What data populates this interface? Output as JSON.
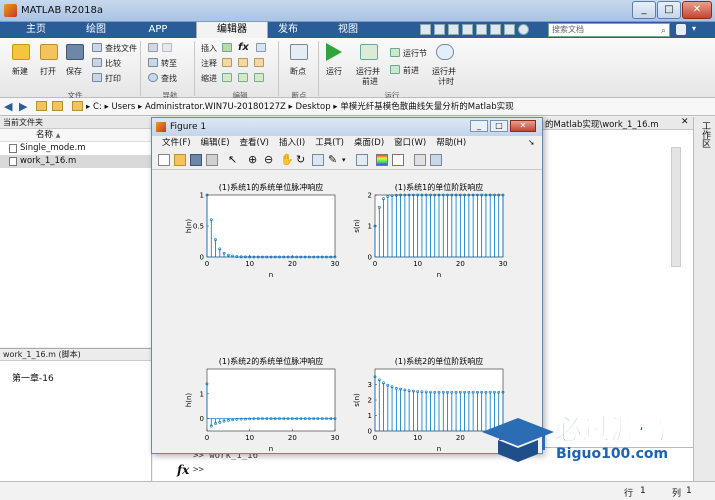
{
  "window": {
    "title": "MATLAB R2018a"
  },
  "tabs": [
    "主页",
    "绘图",
    "APP",
    "编辑器",
    "发布",
    "视图"
  ],
  "search": {
    "placeholder": "搜索文档"
  },
  "ribbon": {
    "file": {
      "new": "新建",
      "open": "打开",
      "save": "保存",
      "find_files": "查找文件",
      "compare": "比较",
      "print": "打印",
      "group": "文件"
    },
    "navigate": {
      "goto": "转至",
      "find": "查找",
      "group": "导航"
    },
    "edit": {
      "insert": "插入",
      "comment": "注释",
      "indent": "缩进",
      "fx": "fx",
      "group": "编辑"
    },
    "breakpoints": {
      "label": "断点",
      "group": "断点"
    },
    "run": {
      "run": "运行",
      "run_advance_1": "运行并",
      "run_advance_2": "前进",
      "run_section": "运行节",
      "advance": "前进",
      "run_time_1": "运行并",
      "run_time_2": "计时",
      "group": "运行"
    }
  },
  "address": {
    "path": [
      "C:",
      "Users",
      "Administrator.WIN7U-20180127Z",
      "Desktop",
      "单模光纤基模色散曲线矢量分析的Matlab实现"
    ]
  },
  "current_folder": {
    "header": "当前文件夹",
    "col_name": "名称",
    "sort": "▲",
    "files": [
      "Single_mode.m",
      "work_1_16.m"
    ]
  },
  "details": {
    "header": "work_1_16.m  (脚本)",
    "content": "第一章-16"
  },
  "editor_tab": "的Matlab实现\\work_1_16.m",
  "workspace_label": "工作区",
  "command": {
    "line1": ">> work_1_16",
    "prompt": ">>",
    "fx": "fx"
  },
  "status": {
    "row_label": "行",
    "row": "1",
    "col_label": "列",
    "col": "1"
  },
  "figure": {
    "title": "Figure 1",
    "menu": [
      "文件(F)",
      "编辑(E)",
      "查看(V)",
      "插入(I)",
      "工具(T)",
      "桌面(D)",
      "窗口(W)",
      "帮助(H)"
    ],
    "plots": [
      {
        "title": "(1)系统1的系统单位脉冲响应",
        "ylabel": "h(n)",
        "xlabel": "n",
        "yticks": [
          "0",
          "0.5",
          "1"
        ],
        "xticks": [
          "0",
          "10",
          "20",
          "30"
        ]
      },
      {
        "title": "(1)系统1的单位阶跃响应",
        "ylabel": "s(n)",
        "xlabel": "n",
        "yticks": [
          "0",
          "1",
          "2"
        ],
        "xticks": [
          "0",
          "10",
          "20",
          "30"
        ]
      },
      {
        "title": "(1)系统2的系统单位脉冲响应",
        "ylabel": "h(n)",
        "xlabel": "n",
        "yticks": [
          "0",
          "1"
        ],
        "xticks": [
          "0",
          "10",
          "20",
          "30"
        ]
      },
      {
        "title": "(1)系统2的单位阶跃响应",
        "ylabel": "s(n)",
        "xlabel": "n",
        "yticks": [
          "0",
          "1",
          "2",
          "3"
        ],
        "xticks": [
          "0",
          "10",
          "20",
          "30"
        ]
      }
    ]
  },
  "watermark": {
    "cn": "必过源码",
    "en": "Biguo100.com"
  },
  "colors": {
    "tabbar": "#2a5c9a",
    "stem": "#0072bd",
    "title_gradient": "#c3d5ea"
  },
  "chart_data": [
    {
      "type": "stem",
      "title": "(1)系统1的系统单位脉冲响应",
      "xlabel": "n",
      "ylabel": "h(n)",
      "xlim": [
        0,
        30
      ],
      "ylim": [
        0,
        1
      ],
      "x": [
        0,
        1,
        2,
        3,
        4,
        5,
        6,
        7,
        8,
        9,
        10,
        11,
        12,
        13,
        14,
        15,
        16,
        17,
        18,
        19,
        20,
        21,
        22,
        23,
        24,
        25,
        26,
        27,
        28,
        29,
        30
      ],
      "values": [
        1,
        0.6,
        0.28,
        0.13,
        0.06,
        0.03,
        0.015,
        0.007,
        0.003,
        0.002,
        0.001,
        0,
        0,
        0,
        0,
        0,
        0,
        0,
        0,
        0,
        0,
        0,
        0,
        0,
        0,
        0,
        0,
        0,
        0,
        0,
        0
      ]
    },
    {
      "type": "stem",
      "title": "(1)系统1的单位阶跃响应",
      "xlabel": "n",
      "ylabel": "s(n)",
      "xlim": [
        0,
        30
      ],
      "ylim": [
        0,
        2
      ],
      "x": [
        0,
        1,
        2,
        3,
        4,
        5,
        6,
        7,
        8,
        9,
        10,
        11,
        12,
        13,
        14,
        15,
        16,
        17,
        18,
        19,
        20,
        21,
        22,
        23,
        24,
        25,
        26,
        27,
        28,
        29,
        30
      ],
      "values": [
        1,
        1.6,
        1.88,
        1.95,
        1.98,
        1.99,
        2,
        2,
        2,
        2,
        2,
        2,
        2,
        2,
        2,
        2,
        2,
        2,
        2,
        2,
        2,
        2,
        2,
        2,
        2,
        2,
        2,
        2,
        2,
        2,
        2
      ]
    },
    {
      "type": "stem",
      "title": "(1)系统2的系统单位脉冲响应",
      "xlabel": "n",
      "ylabel": "h(n)",
      "xlim": [
        0,
        30
      ],
      "ylim": [
        -0.5,
        2
      ],
      "x": [
        0,
        1,
        2,
        3,
        4,
        5,
        6,
        7,
        8,
        9,
        10,
        11,
        12,
        13,
        14,
        15,
        16,
        17,
        18,
        19,
        20,
        21,
        22,
        23,
        24,
        25,
        26,
        27,
        28,
        29,
        30
      ],
      "values": [
        1.4,
        -0.3,
        -0.2,
        -0.15,
        -0.1,
        -0.07,
        -0.05,
        -0.03,
        -0.02,
        -0.015,
        -0.01,
        -0.005,
        0,
        0,
        0,
        0,
        0,
        0,
        0,
        0,
        0,
        0,
        0,
        0,
        0,
        0,
        0,
        0,
        0,
        0,
        0
      ]
    },
    {
      "type": "stem",
      "title": "(1)系统2的单位阶跃响应",
      "xlabel": "n",
      "ylabel": "s(n)",
      "xlim": [
        0,
        30
      ],
      "ylim": [
        0,
        4
      ],
      "x": [
        0,
        1,
        2,
        3,
        4,
        5,
        6,
        7,
        8,
        9,
        10,
        11,
        12,
        13,
        14,
        15,
        16,
        17,
        18,
        19,
        20,
        21,
        22,
        23,
        24,
        25,
        26,
        27,
        28,
        29,
        30
      ],
      "values": [
        3.5,
        3.3,
        3.1,
        2.95,
        2.85,
        2.75,
        2.7,
        2.65,
        2.6,
        2.57,
        2.55,
        2.53,
        2.52,
        2.51,
        2.5,
        2.5,
        2.5,
        2.5,
        2.5,
        2.5,
        2.5,
        2.5,
        2.5,
        2.5,
        2.5,
        2.5,
        2.5,
        2.5,
        2.5,
        2.5,
        2.5
      ]
    }
  ]
}
